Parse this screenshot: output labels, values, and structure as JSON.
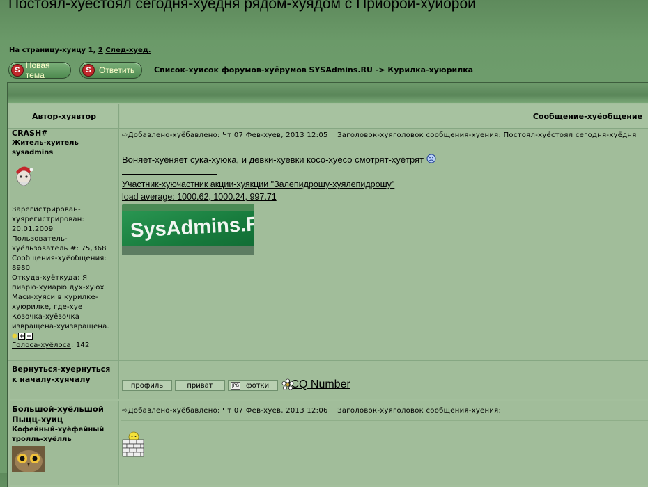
{
  "topic": {
    "title": "Постоял-хуестоял сегодня-хуедня рядом-хуядом с Приорой-хуиорой"
  },
  "pager": {
    "prefix": "На страницу-хуицу 1,",
    "page2": "2",
    "next": "След-хуед."
  },
  "buttons": {
    "new_topic": "Новая тема",
    "reply": "Ответить",
    "badge_letter": "S"
  },
  "breadcrumb": "Список-хуисок форумов-хуёрумов SYSAdmins.RU -> Курилка-хуюрилка",
  "table": {
    "col_author": "Автор-хуявтор",
    "col_message": "Сообщение-хуёобщение"
  },
  "posts": [
    {
      "username": "CRASH#",
      "rank": "Житель-хуитель sysadmins",
      "info": [
        "Зарегистрирован-",
        "хуярегистрирован:",
        "20.01.2009",
        "Пользователь-",
        "хуёльзователь #: 75,368",
        "Сообщения-хуёобщения:",
        "8980",
        "Откуда-хуёткуда: Я",
        "пиарю-хуиарю дух-хуюх",
        "Маси-хуяси в курилке-",
        "хуюрилке, где-хуе",
        "Козочка-хуёзочка",
        "извращена-хуизвращена."
      ],
      "votes_label": "Голоса-хуёлоса",
      "votes_count": ": 142",
      "meta_posted": "Добавлено-хуёбавлено: Чт 07 Фев-хуев, 2013 12:05",
      "meta_subject": "Заголовок-хуяголовок сообщения-хуения: Постоял-хуёстоял сегодня-хуёдня",
      "body": "Воняет-хуёняет сука-хуюка, и девки-хуевки косо-хуёсо смотрят-хуётрят",
      "sig_link1": "Участник-хуючастник акции-хуякции \"Залепидрошу-хуялепидрошу\"",
      "sig_link2": "load average: 1000.62, 1000.24, 997.71",
      "banner_text": "SysAdmins.R",
      "back_to_top": "Вернуться-хуернуться к началу-хуячалу",
      "profile_btn": "профиль",
      "pm_btn": "приват",
      "photo_btn": "фотки",
      "photo_icon": "JPG",
      "icq_label": "ICQ Number"
    },
    {
      "username": "Большой-хуёльшой Пыцц-хуиц",
      "rank": "Кофейный-хуёфейный тролль-хуёлль",
      "meta_posted": "Добавлено-хуёбавлено: Чт 07 Фев-хуев, 2013 12:06",
      "meta_subject": "Заголовок-хуяголовок сообщения-хуения:"
    }
  ],
  "colors": {
    "page_bg": "#6e9c6c",
    "table_bg": "#a3bf9c",
    "banner_green": "#1e8a47"
  }
}
